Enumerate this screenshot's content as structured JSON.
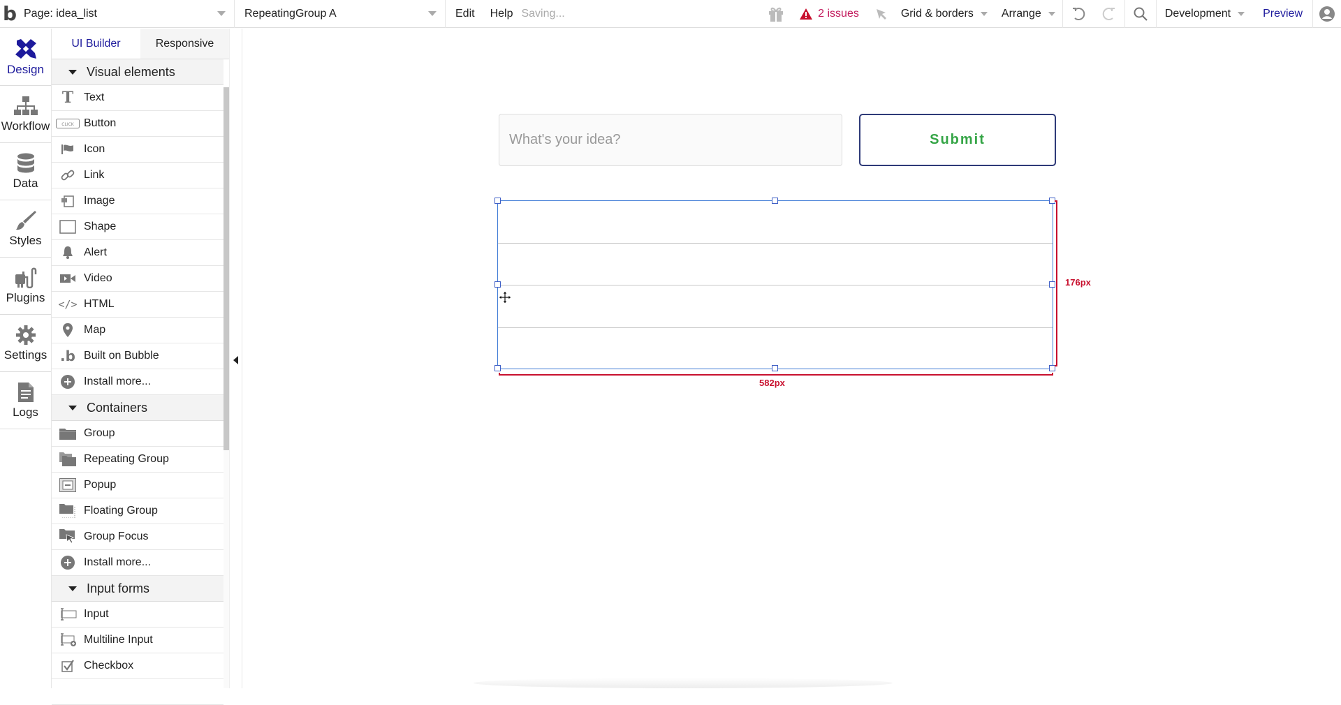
{
  "topbar": {
    "logo": "b",
    "page_select": "Page: idea_list",
    "element_select": "RepeatingGroup A",
    "menu": [
      "Edit",
      "Help"
    ],
    "status": "Saving...",
    "issues_label": "2 issues",
    "grid_label": "Grid & borders",
    "arrange_label": "Arrange",
    "env_label": "Development",
    "preview_label": "Preview",
    "colors": {
      "accent": "#1d1a9c",
      "issues": "#c2185b"
    }
  },
  "leftnav": {
    "items": [
      {
        "label": "Design",
        "icon": "design-icon",
        "active": true
      },
      {
        "label": "Workflow",
        "icon": "workflow-icon"
      },
      {
        "label": "Data",
        "icon": "database-icon"
      },
      {
        "label": "Styles",
        "icon": "brush-icon"
      },
      {
        "label": "Plugins",
        "icon": "plug-icon"
      },
      {
        "label": "Settings",
        "icon": "gear-icon"
      },
      {
        "label": "Logs",
        "icon": "document-icon"
      }
    ]
  },
  "panel": {
    "tabs": [
      {
        "label": "UI Builder",
        "active": true
      },
      {
        "label": "Responsive"
      }
    ],
    "sections": [
      {
        "title": "Visual elements",
        "items": [
          {
            "label": "Text",
            "icon": "text-icon"
          },
          {
            "label": "Button",
            "icon": "button-icon"
          },
          {
            "label": "Icon",
            "icon": "flag-icon"
          },
          {
            "label": "Link",
            "icon": "link-icon"
          },
          {
            "label": "Image",
            "icon": "image-icon"
          },
          {
            "label": "Shape",
            "icon": "shape-icon"
          },
          {
            "label": "Alert",
            "icon": "bell-icon"
          },
          {
            "label": "Video",
            "icon": "video-icon"
          },
          {
            "label": "HTML",
            "icon": "code-icon"
          },
          {
            "label": "Map",
            "icon": "map-pin-icon"
          },
          {
            "label": "Built on Bubble",
            "icon": "bubble-logo-icon"
          },
          {
            "label": "Install more...",
            "icon": "plus-circle-icon"
          }
        ]
      },
      {
        "title": "Containers",
        "items": [
          {
            "label": "Group",
            "icon": "folder-icon"
          },
          {
            "label": "Repeating Group",
            "icon": "folders-icon"
          },
          {
            "label": "Popup",
            "icon": "popup-icon"
          },
          {
            "label": "Floating Group",
            "icon": "floating-folder-icon"
          },
          {
            "label": "Group Focus",
            "icon": "folder-cursor-icon"
          },
          {
            "label": "Install more...",
            "icon": "plus-circle-icon"
          }
        ]
      },
      {
        "title": "Input forms",
        "items": [
          {
            "label": "Input",
            "icon": "input-icon"
          },
          {
            "label": "Multiline Input",
            "icon": "multiline-input-icon"
          },
          {
            "label": "Checkbox",
            "icon": "checkbox-icon"
          }
        ]
      }
    ]
  },
  "canvas": {
    "input_placeholder": "What's your idea?",
    "submit_label": "Submit",
    "repeating_group": {
      "name": "RepeatingGroup A",
      "rows": 4,
      "width_label": "582px",
      "height_label": "176px"
    },
    "colors": {
      "submit_border": "#2e3a78",
      "submit_text": "#35a546",
      "selection": "#3f7bd6",
      "dimension": "#c8102e"
    }
  }
}
